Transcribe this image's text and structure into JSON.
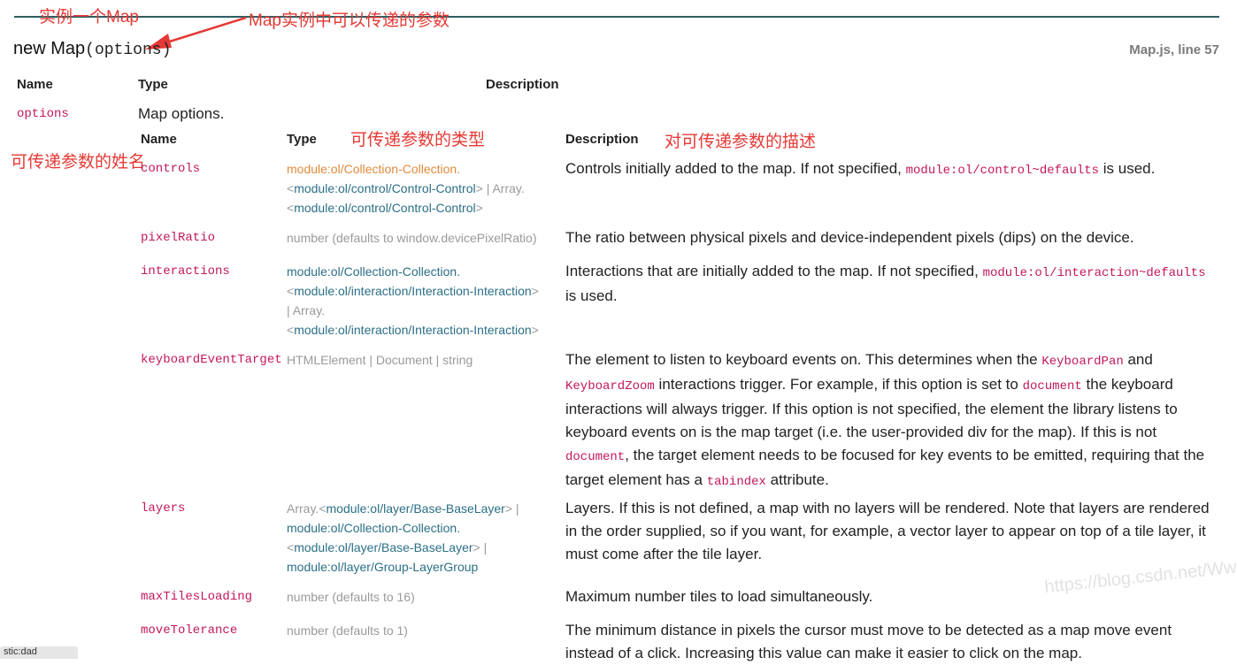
{
  "annotations": {
    "instance": "实例一个Map",
    "params_passable": "Map实例中可以传递的参数",
    "param_names": "可传递参数的姓名",
    "param_types": "可传递参数的类型",
    "param_desc": "对可传递参数的描述"
  },
  "signature": {
    "keyword": "new Map",
    "params": "(options)"
  },
  "source_ref": "Map.js, line 57",
  "outer_headers": {
    "name": "Name",
    "type": "Type",
    "description": "Description"
  },
  "outer_param": {
    "name": "options",
    "type": "Map options."
  },
  "inner_headers": {
    "name": "Name",
    "type": "Type",
    "description": "Description"
  },
  "rows": [
    {
      "name": "controls",
      "type": [
        "module:ol/Collection-Collection.",
        "<",
        "module:ol/control/Control-Control",
        "> | Array.",
        "<",
        "module:ol/control/Control-Control",
        ">"
      ],
      "desc": [
        "Controls initially added to the map. If not specified, ",
        "module:ol/control~defaults",
        " is used."
      ]
    },
    {
      "name": "pixelRatio",
      "type": "number (defaults to window.devicePixelRatio)",
      "desc": "The ratio between physical pixels and device-independent pixels (dips) on the device."
    },
    {
      "name": "interactions",
      "type": [
        "module:ol/Collection-Collection.",
        "<",
        "module:ol/interaction/Interaction-Interaction",
        ">",
        " | Array.",
        "<",
        "module:ol/interaction/Interaction-Interaction",
        ">"
      ],
      "desc": [
        "Interactions that are initially added to the map. If not specified, ",
        "module:ol/interaction~defaults",
        " is used."
      ]
    },
    {
      "name": "keyboardEventTarget",
      "type": "HTMLElement | Document | string",
      "desc": [
        "The element to listen to keyboard events on. This determines when the ",
        "KeyboardPan",
        " and ",
        "KeyboardZoom",
        " interactions trigger. For example, if this option is set to ",
        "document",
        " the keyboard interactions will always trigger. If this option is not specified, the element the library listens to keyboard events on is the map target (i.e. the user-provided div for the map). If this is not ",
        "document",
        ", the target element needs to be focused for key events to be emitted, requiring that the target element has a ",
        "tabindex",
        " attribute."
      ]
    },
    {
      "name": "layers",
      "type": [
        "Array.",
        "<",
        "module:ol/layer/Base-BaseLayer",
        "> | ",
        "module:ol/Collection-Collection.",
        "<",
        "module:ol/layer/Base-BaseLayer",
        "> | ",
        "module:ol/layer/Group-LayerGroup"
      ],
      "desc": "Layers. If this is not defined, a map with no layers will be rendered. Note that layers are rendered in the order supplied, so if you want, for example, a vector layer to appear on top of a tile layer, it must come after the tile layer."
    },
    {
      "name": "maxTilesLoading",
      "type": "number (defaults to 16)",
      "desc": "Maximum number tiles to load simultaneously."
    },
    {
      "name": "moveTolerance",
      "type": "number (defaults to 1)",
      "desc": "The minimum distance in pixels the cursor must move to be detected as a map move event instead of a click. Increasing this value can make it easier to click on the map."
    }
  ],
  "watermark": "https://blog.csdn.net/Wwinky",
  "footer_tab": "stic:dad"
}
